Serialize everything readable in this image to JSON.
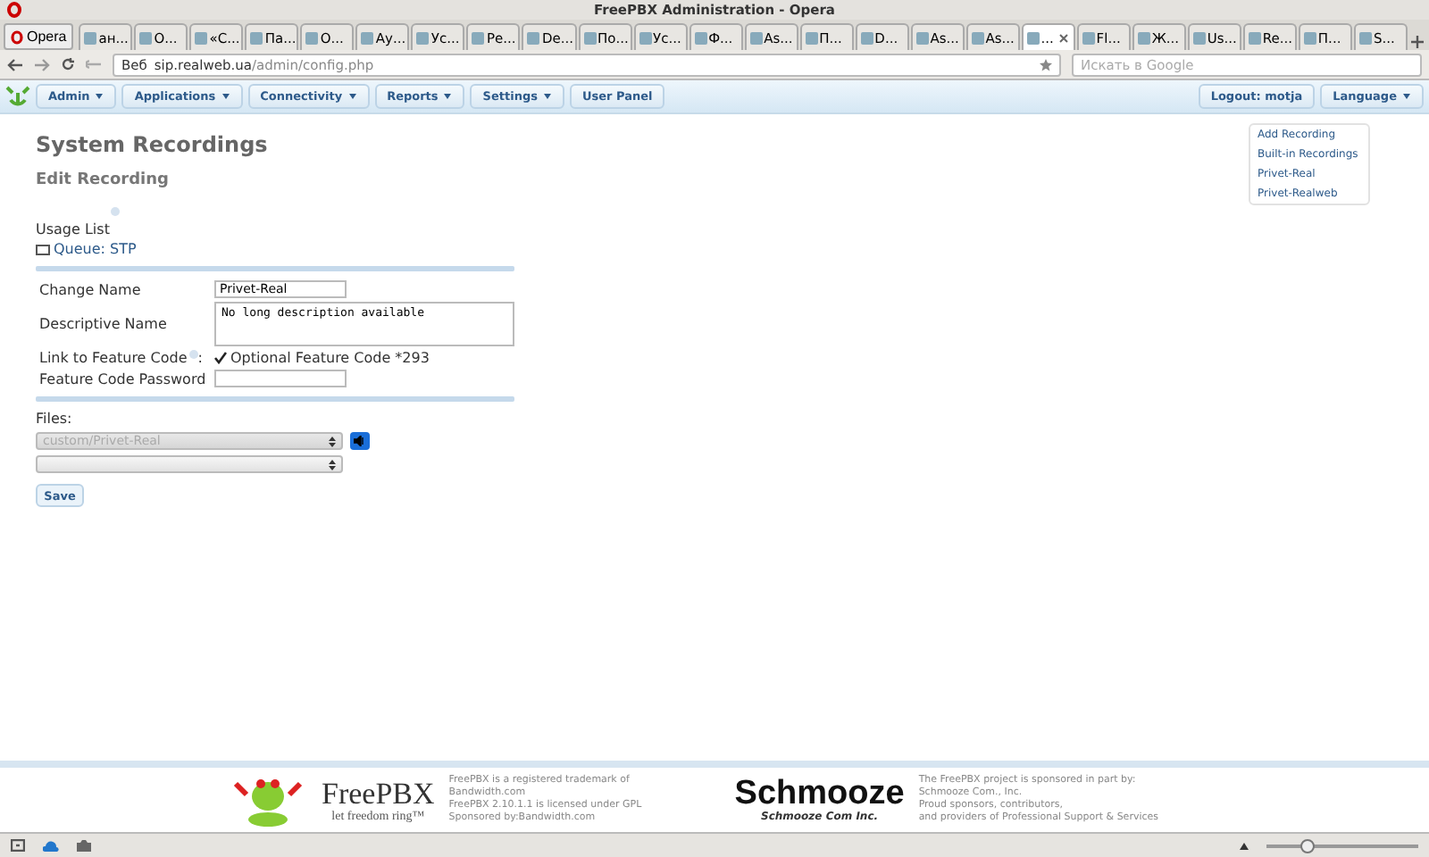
{
  "window": {
    "title": "FreePBX Administration - Opera"
  },
  "browser": {
    "menu_button": "Opera",
    "tabs": [
      {
        "label": "ан...",
        "selected": false
      },
      {
        "label": "О...",
        "selected": false
      },
      {
        "label": "«С...",
        "selected": false
      },
      {
        "label": "Па...",
        "selected": false
      },
      {
        "label": "О...",
        "selected": false
      },
      {
        "label": "Ау...",
        "selected": false
      },
      {
        "label": "Ус...",
        "selected": false
      },
      {
        "label": "Ре...",
        "selected": false
      },
      {
        "label": "De...",
        "selected": false
      },
      {
        "label": "По...",
        "selected": false
      },
      {
        "label": "Ус...",
        "selected": false
      },
      {
        "label": "Ф...",
        "selected": false
      },
      {
        "label": "As...",
        "selected": false
      },
      {
        "label": "П...",
        "selected": false
      },
      {
        "label": "D...",
        "selected": false
      },
      {
        "label": "As...",
        "selected": false
      },
      {
        "label": "As...",
        "selected": false
      },
      {
        "label": "...",
        "selected": true
      },
      {
        "label": "Fl...",
        "selected": false
      },
      {
        "label": "Ж...",
        "selected": false
      },
      {
        "label": "Us...",
        "selected": false
      },
      {
        "label": "Re...",
        "selected": false
      },
      {
        "label": "П...",
        "selected": false
      },
      {
        "label": "S...",
        "selected": false
      }
    ],
    "address": {
      "badge": "Веб",
      "host": "sip.realweb.ua",
      "path": "/admin/config.php"
    },
    "search": {
      "placeholder": "Искать в Google"
    },
    "zoom": {
      "level": 0.27
    }
  },
  "nav": {
    "menus": [
      {
        "label": "Admin",
        "dropdown": true
      },
      {
        "label": "Applications",
        "dropdown": true
      },
      {
        "label": "Connectivity",
        "dropdown": true
      },
      {
        "label": "Reports",
        "dropdown": true
      },
      {
        "label": "Settings",
        "dropdown": true
      },
      {
        "label": "User Panel",
        "dropdown": false
      }
    ],
    "right": [
      {
        "label": "Logout: motja",
        "dropdown": false
      },
      {
        "label": "Language",
        "dropdown": true
      }
    ]
  },
  "page": {
    "title": "System Recordings",
    "subtitle": "Edit Recording",
    "usage_label": "Usage List",
    "usage_item": "Queue: STP",
    "fields": [
      {
        "kind": "input",
        "label": "Change Name",
        "value": "Privet-Real"
      },
      {
        "kind": "textarea",
        "label": "Descriptive Name",
        "value": "No long description available"
      },
      {
        "kind": "checkbox",
        "label": "Link to Feature Code",
        "suffix": ":",
        "checked": true,
        "text": "Optional Feature Code *293"
      },
      {
        "kind": "input",
        "label": "Feature Code Password"
      }
    ],
    "files_label": "Files:",
    "files": [
      {
        "value": "custom/Privet-Real",
        "disabled": true,
        "play": true
      },
      {
        "disabled": false,
        "play": false
      }
    ],
    "save": "Save"
  },
  "sidebar": {
    "items": [
      "Add Recording",
      "Built-in Recordings",
      "Privet-Real",
      "Privet-Realweb"
    ]
  },
  "footer": {
    "logo_name": "FreePBX",
    "logo_tagline": "let freedom ring™",
    "lines": [
      "FreePBX is a registered trademark of Bandwidth.com",
      "FreePBX 2.10.1.1 is licensed under GPL",
      "Sponsored by:Bandwidth.com"
    ],
    "sponsor_logo": "Schmooze",
    "sponsor_sub": "Schmooze Com Inc.",
    "sponsor_lines": [
      "The FreePBX project is sponsored in part by:",
      "Schmooze Com., Inc.",
      "Proud sponsors, contributors,",
      "and providers of Professional Support & Services"
    ]
  }
}
